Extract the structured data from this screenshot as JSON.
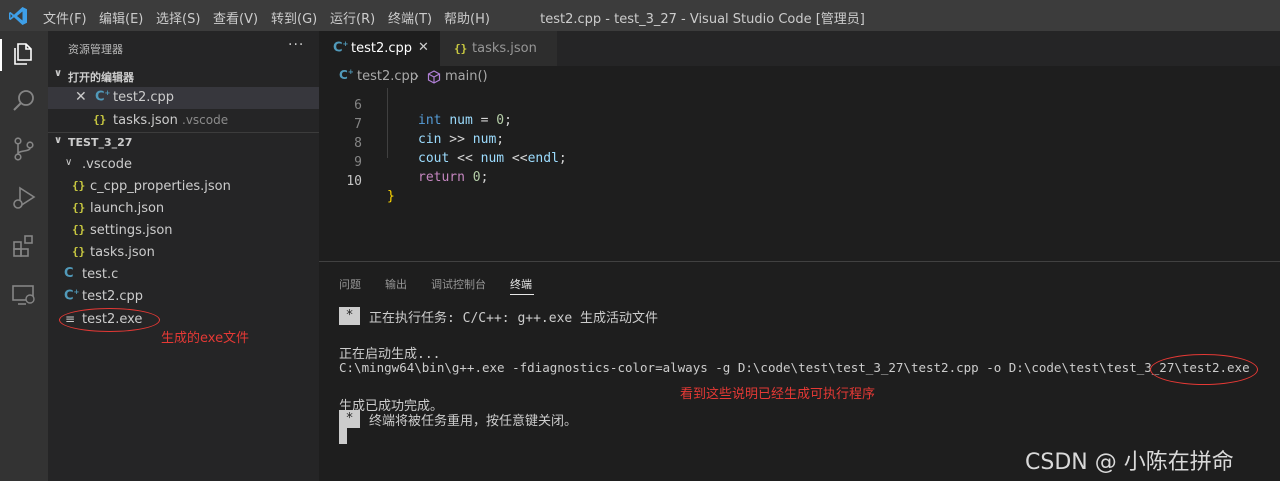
{
  "titlebar": {
    "menu": [
      "文件(F)",
      "编辑(E)",
      "选择(S)",
      "查看(V)",
      "转到(G)",
      "运行(R)",
      "终端(T)",
      "帮助(H)"
    ],
    "window_title": "test2.cpp - test_3_27 - Visual Studio Code [管理员]"
  },
  "activitybar": {
    "icons": [
      "files-icon",
      "search-icon",
      "source-control-icon",
      "run-debug-icon",
      "extensions-icon",
      "remote-explorer-icon"
    ]
  },
  "sidebar": {
    "title": "资源管理器",
    "more": "···",
    "open_editors": {
      "header": "打开的编辑器",
      "items": [
        {
          "name": "test2.cpp",
          "desc": ""
        },
        {
          "name": "tasks.json",
          "desc": ".vscode"
        }
      ]
    },
    "folder": {
      "header": "TEST_3_27",
      "items": [
        {
          "name": ".vscode",
          "type": "folder"
        },
        {
          "name": "c_cpp_properties.json",
          "type": "json"
        },
        {
          "name": "launch.json",
          "type": "json"
        },
        {
          "name": "settings.json",
          "type": "json"
        },
        {
          "name": "tasks.json",
          "type": "json"
        },
        {
          "name": "test.c",
          "type": "c"
        },
        {
          "name": "test2.cpp",
          "type": "cpp"
        },
        {
          "name": "test2.exe",
          "type": "exe"
        }
      ]
    }
  },
  "editor": {
    "tabs": [
      {
        "label": "test2.cpp",
        "active": true
      },
      {
        "label": "tasks.json",
        "active": false
      }
    ],
    "breadcrumb": {
      "file": "test2.cpp",
      "symbol": "main()"
    },
    "lines": [
      {
        "n": "6",
        "code": "int num = 0;"
      },
      {
        "n": "7",
        "code": "cin >> num;"
      },
      {
        "n": "8",
        "code": "cout << num <<endl;"
      },
      {
        "n": "9",
        "code": "return 0;"
      },
      {
        "n": "10",
        "code": "}"
      }
    ],
    "tokens": {
      "int": "int",
      "num": "num",
      "eq": " = ",
      "zero": "0",
      "semi": ";",
      "cin": "cin",
      "shr": " >> ",
      "cout": "cout",
      "shl": " << ",
      "shl2": " <<",
      "endl": "endl",
      "return": "return",
      "sp": " ",
      "brace": "}"
    }
  },
  "panel": {
    "tabs": [
      "问题",
      "输出",
      "调试控制台",
      "终端"
    ],
    "active_tab": "终端",
    "terminal": {
      "star": "*",
      "task_line": "正在执行任务: C/C++: g++.exe 生成活动文件",
      "start_line": "正在启动生成...",
      "command_line": "C:\\mingw64\\bin\\g++.exe -fdiagnostics-color=always -g D:\\code\\test\\test_3_27\\test2.cpp -o D:\\code\\test\\test_3_27\\test2.exe",
      "done_line": "生成已成功完成。",
      "reuse_line": "终端将被任务重用，按任意键关闭。"
    }
  },
  "annotations": {
    "exe_note": "生成的exe文件",
    "terminal_note": "看到这些说明已经生成可执行程序"
  },
  "watermark": "CSDN @  小陈在拼命",
  "colors": {
    "accent_red": "#e53935",
    "json_icon": "#cbcb41",
    "cpp_icon": "#519aba"
  }
}
